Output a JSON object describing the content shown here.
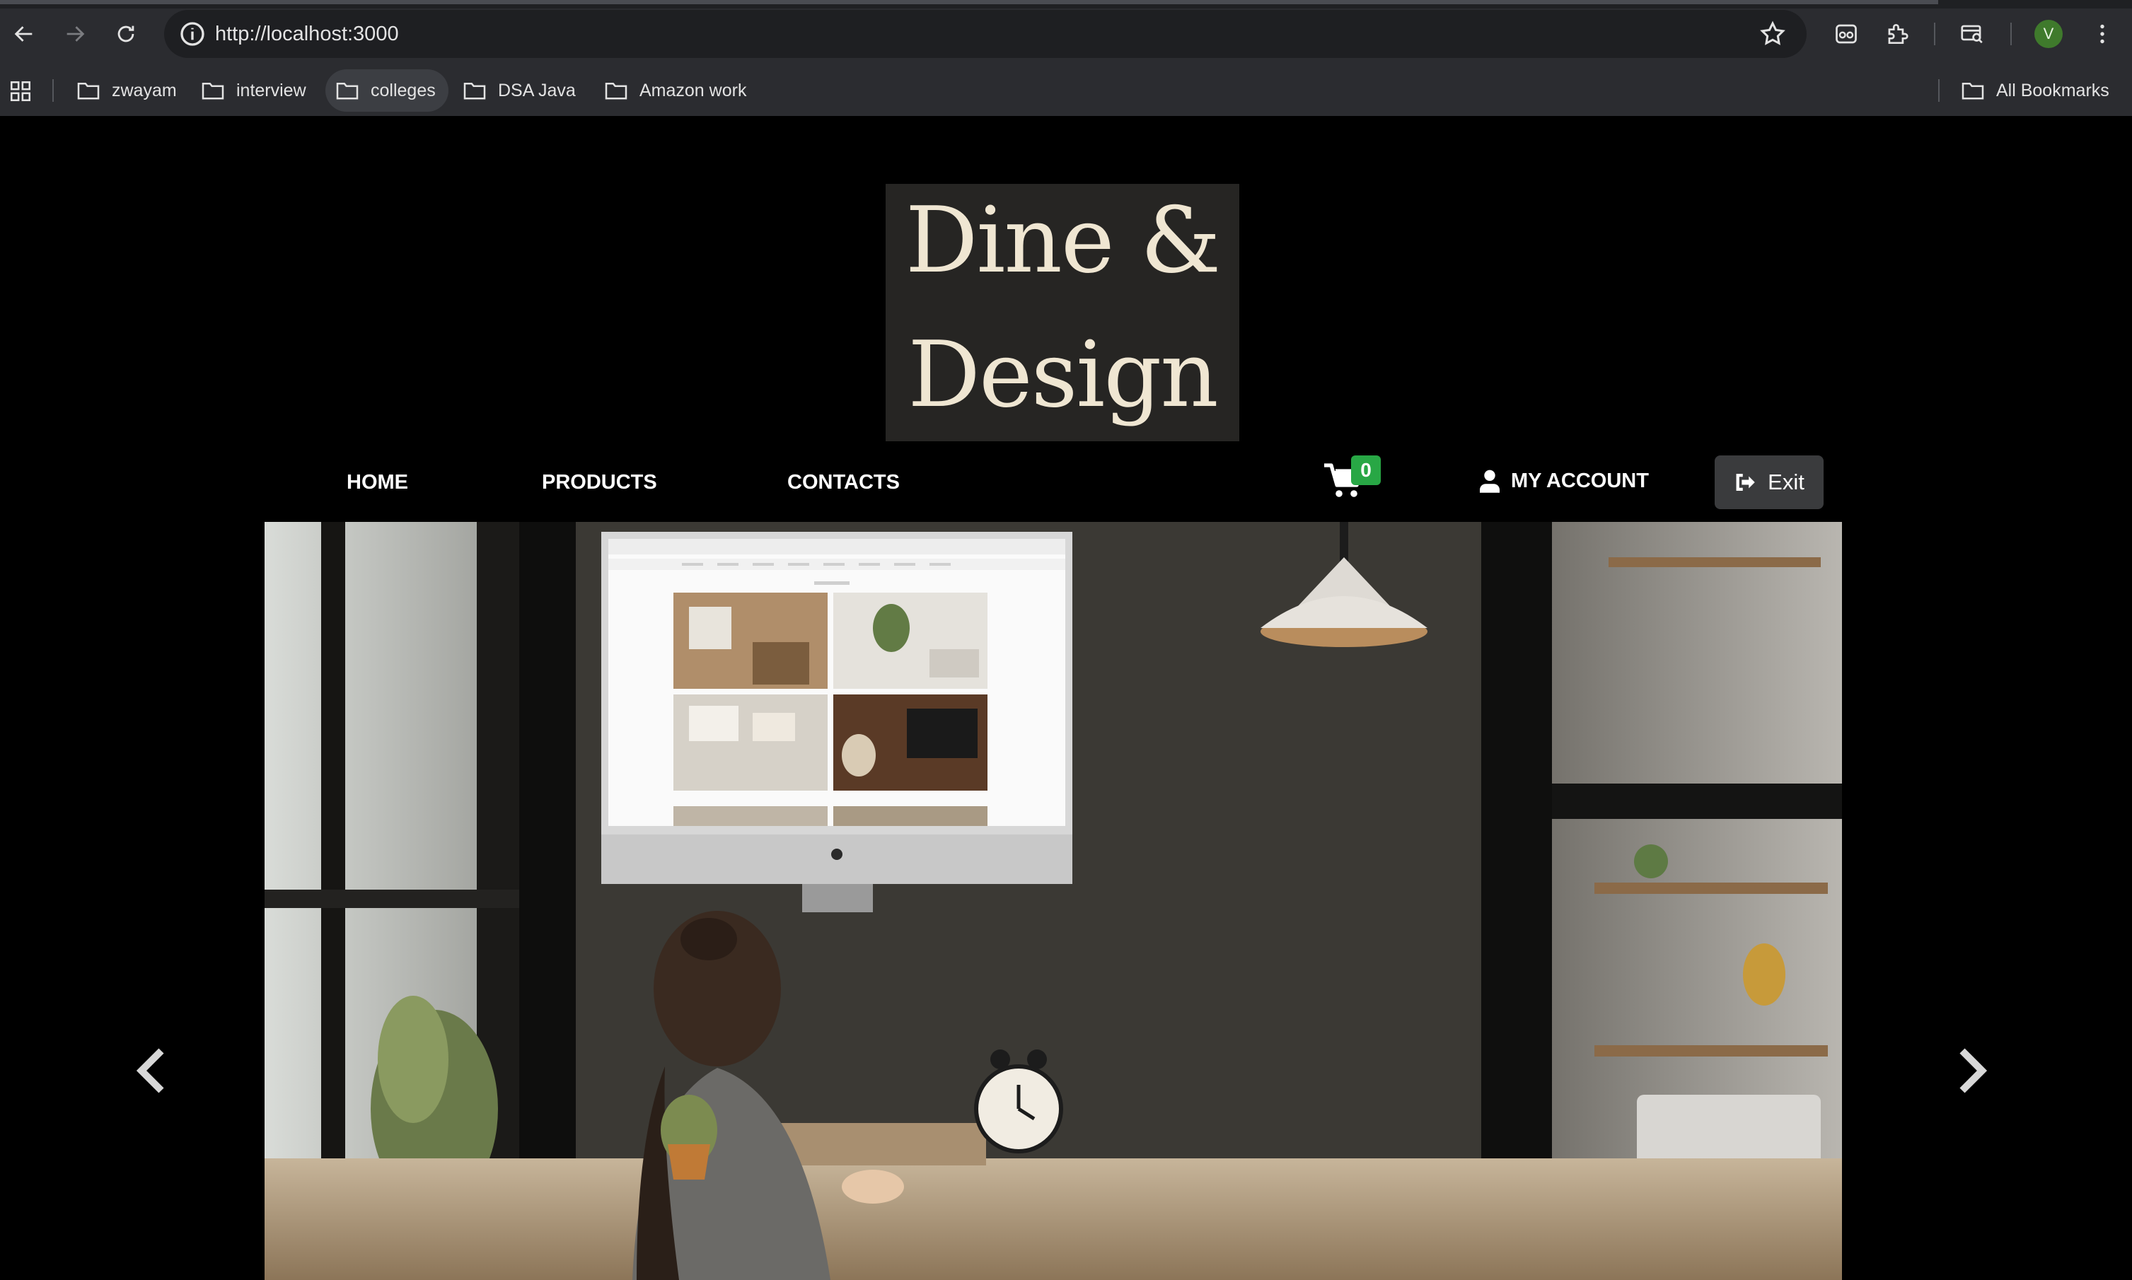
{
  "browser": {
    "url": "http://localhost:3000",
    "profile_initial": "V",
    "bookmarks": [
      {
        "label": "zwayam"
      },
      {
        "label": "interview"
      },
      {
        "label": "colleges"
      },
      {
        "label": "DSA Java"
      },
      {
        "label": "Amazon work"
      }
    ],
    "all_bookmarks_label": "All Bookmarks"
  },
  "site": {
    "logo_line1": "Dine &",
    "logo_line2": "Design",
    "nav": {
      "home": "HOME",
      "products": "PRODUCTS",
      "contacts": "CONTACTS"
    },
    "cart_count": "0",
    "account_label": "MY ACCOUNT",
    "exit_label": "Exit"
  },
  "hero": {
    "image": "woman-at-desk-browsing-interior-design-website",
    "prev_icon": "chevron-left-icon",
    "next_icon": "chevron-right-icon"
  },
  "colors": {
    "page_bg": "#000000",
    "logo_bg": "#262523",
    "logo_text": "#efe6d2",
    "cart_badge": "#28a745",
    "exit_button": "#3a3b3d"
  }
}
